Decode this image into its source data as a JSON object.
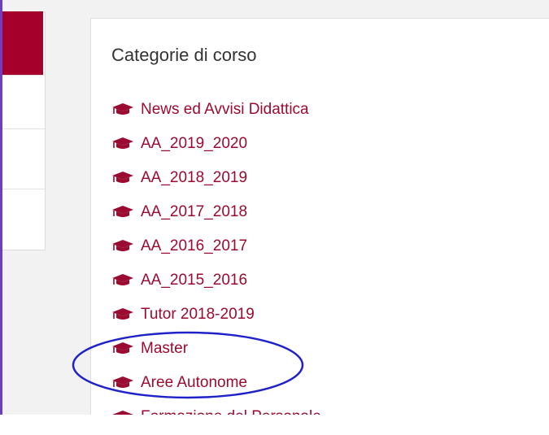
{
  "block": {
    "title": "Categorie di corso"
  },
  "categories": [
    {
      "label": "News ed Avvisi Didattica",
      "icon": "graduation-cap-icon"
    },
    {
      "label": "AA_2019_2020",
      "icon": "graduation-cap-icon"
    },
    {
      "label": "AA_2018_2019",
      "icon": "graduation-cap-icon"
    },
    {
      "label": "AA_2017_2018",
      "icon": "graduation-cap-icon"
    },
    {
      "label": "AA_2016_2017",
      "icon": "graduation-cap-icon"
    },
    {
      "label": "AA_2015_2016",
      "icon": "graduation-cap-icon"
    },
    {
      "label": "Tutor 2018-2019",
      "icon": "graduation-cap-icon"
    },
    {
      "label": "Master",
      "icon": "graduation-cap-icon"
    },
    {
      "label": "Aree Autonome",
      "icon": "graduation-cap-icon"
    },
    {
      "label": "Formazione del Personale",
      "icon": "graduation-cap-icon"
    }
  ],
  "colors": {
    "link": "#9b0a30",
    "nav_active": "#a5002b",
    "annotation": "#1f22c8",
    "frame": "#6d3fc0"
  }
}
